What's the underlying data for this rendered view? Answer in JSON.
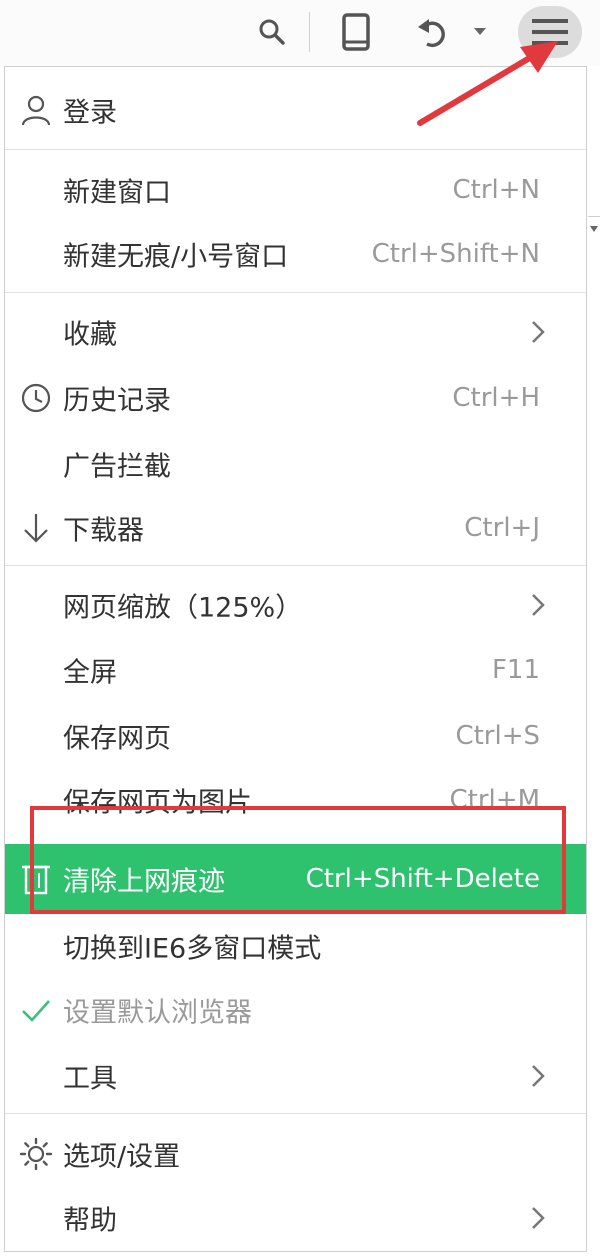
{
  "menu": {
    "login": {
      "label": "登录",
      "icon": "user-icon"
    },
    "groups": [
      [
        {
          "id": "new-window",
          "label": "新建窗口",
          "shortcut": "Ctrl+N"
        },
        {
          "id": "new-incognito",
          "label": "新建无痕/小号窗口",
          "shortcut": "Ctrl+Shift+N"
        }
      ],
      [
        {
          "id": "favorites",
          "label": "收藏",
          "submenu": true
        },
        {
          "id": "history",
          "label": "历史记录",
          "shortcut": "Ctrl+H",
          "icon": "clock-icon"
        },
        {
          "id": "ad-block",
          "label": "广告拦截"
        },
        {
          "id": "downloads",
          "label": "下载器",
          "shortcut": "Ctrl+J",
          "icon": "download-icon"
        }
      ],
      [
        {
          "id": "zoom",
          "label": "网页缩放（125%）",
          "submenu": true
        },
        {
          "id": "fullscreen",
          "label": "全屏",
          "shortcut": "F11"
        },
        {
          "id": "save-page",
          "label": "保存网页",
          "shortcut": "Ctrl+S"
        },
        {
          "id": "save-as-image",
          "label": "保存网页为图片",
          "shortcut": "Ctrl+M"
        },
        {
          "id": "clear-traces",
          "label": "清除上网痕迹",
          "shortcut": "Ctrl+Shift+Delete",
          "icon": "trash-icon",
          "highlighted": true
        },
        {
          "id": "ie6-mode",
          "label": "切换到IE6多窗口模式"
        },
        {
          "id": "default-browser",
          "label": "设置默认浏览器",
          "icon": "check-icon",
          "disabled": true
        },
        {
          "id": "tools",
          "label": "工具",
          "submenu": true
        }
      ],
      [
        {
          "id": "options",
          "label": "选项/设置",
          "icon": "gear-icon"
        },
        {
          "id": "help",
          "label": "帮助",
          "submenu": true
        }
      ]
    ]
  },
  "colors": {
    "highlight": "#2ec16e",
    "annotation": "#e0393e"
  }
}
